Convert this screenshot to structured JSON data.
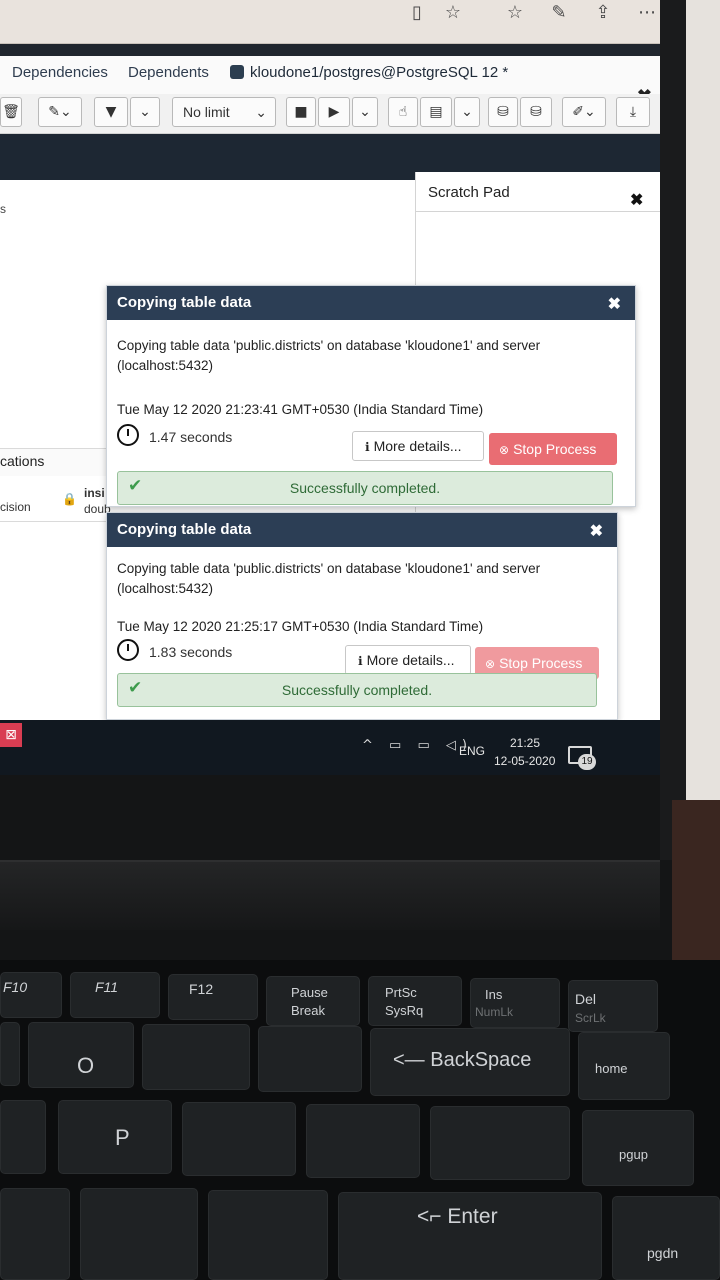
{
  "browser": {
    "icons": [
      "reading-view-icon",
      "favorite-star-icon",
      "favorites-bar-icon",
      "pen-icon",
      "share-icon",
      "more-icon"
    ]
  },
  "tabs": {
    "dependencies": "Dependencies",
    "dependents": "Dependents",
    "query_tab": "kloudone1/postgres@PostgreSQL 12 *",
    "close": "✖"
  },
  "toolbar": {
    "limit": "No limit"
  },
  "scratch_pad": {
    "title": "Scratch Pad",
    "close": "✖"
  },
  "editor": {
    "partial_s": "s",
    "results_label": "cations",
    "col1": "cision",
    "col2": "insi",
    "col2b": "doub"
  },
  "notifications": [
    {
      "title": "Copying table data",
      "close": "✖",
      "message": "Copying table data 'public.districts' on database 'kloudone1' and server (localhost:5432)",
      "time": "Tue May 12 2020 21:23:41 GMT+0530 (India Standard Time)",
      "duration": "1.47 seconds",
      "more_details": "More details...",
      "stop_process": "Stop Process",
      "status": "Successfully completed."
    },
    {
      "title": "Copying table data",
      "close": "✖",
      "message": "Copying table data 'public.districts' on database 'kloudone1' and server (localhost:5432)",
      "time": "Tue May 12 2020 21:25:17 GMT+0530 (India Standard Time)",
      "duration": "1.83 seconds",
      "more_details": "More details...",
      "stop_process": "Stop Process",
      "status": "Successfully completed."
    }
  ],
  "taskbar": {
    "language": "ENG",
    "time": "21:25",
    "date": "12-05-2020",
    "notification_count": "19"
  },
  "keyboard": {
    "f10": "F10",
    "f11": "F11",
    "f12": "F12",
    "pause": "Pause",
    "break": "Break",
    "prtsc": "PrtSc",
    "sysrq": "SysRq",
    "ins": "Ins",
    "numlk": "NumLk",
    "del": "Del",
    "scrlk": "ScrLk",
    "backspace": "BackSpace",
    "home": "home",
    "pgup": "pgup",
    "pgdn": "pgdn",
    "enter": "Enter",
    "p": "P",
    "o": "O"
  },
  "colors": {
    "header_navy": "#2c3e55",
    "stop_red": "#e96d73",
    "success_green": "#dcebdc"
  }
}
